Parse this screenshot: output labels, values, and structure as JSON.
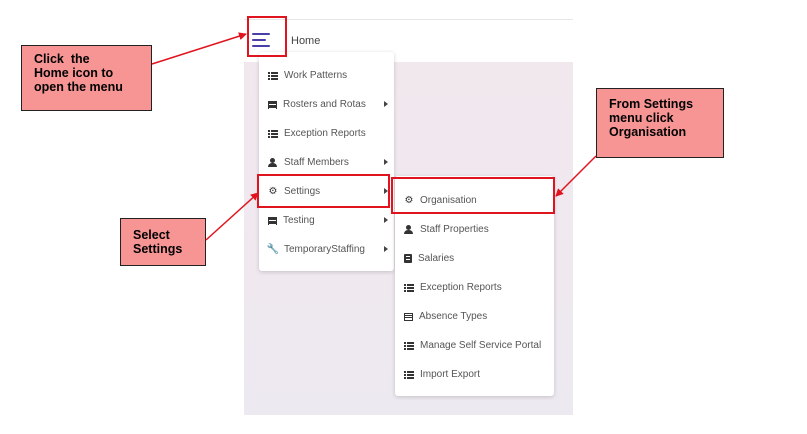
{
  "header": {
    "home_label": "Home"
  },
  "main_menu": {
    "items": [
      {
        "label": "Work Patterns",
        "icon": "list-icon",
        "has_submenu": false
      },
      {
        "label": "Rosters and Rotas",
        "icon": "calendar-icon",
        "has_submenu": true
      },
      {
        "label": "Exception Reports",
        "icon": "list-icon",
        "has_submenu": false
      },
      {
        "label": "Staff Members",
        "icon": "user-icon",
        "has_submenu": true
      },
      {
        "label": "Settings",
        "icon": "gear-icon",
        "has_submenu": true
      },
      {
        "label": "Testing",
        "icon": "calendar-icon",
        "has_submenu": true
      },
      {
        "label": "TemporaryStaffing",
        "icon": "wrench-icon",
        "has_submenu": true
      }
    ]
  },
  "settings_submenu": {
    "items": [
      {
        "label": "Organisation",
        "icon": "gear-icon"
      },
      {
        "label": "Staff Properties",
        "icon": "user-icon"
      },
      {
        "label": "Salaries",
        "icon": "calculator-icon"
      },
      {
        "label": "Exception Reports",
        "icon": "list-icon"
      },
      {
        "label": "Absence Types",
        "icon": "table-icon"
      },
      {
        "label": "Manage Self Service Portal",
        "icon": "list-icon"
      },
      {
        "label": "Import Export",
        "icon": "list-icon"
      }
    ]
  },
  "callouts": {
    "home": [
      "Click  the",
      "Home icon to",
      "open the menu"
    ],
    "settings": [
      "Select",
      "Settings"
    ],
    "organisation": [
      "From Settings",
      "menu click",
      "Organisation"
    ]
  },
  "colors": {
    "highlight": "#e0141e",
    "callout_fill": "#f79494",
    "hamburger": "#4a3fa8"
  }
}
